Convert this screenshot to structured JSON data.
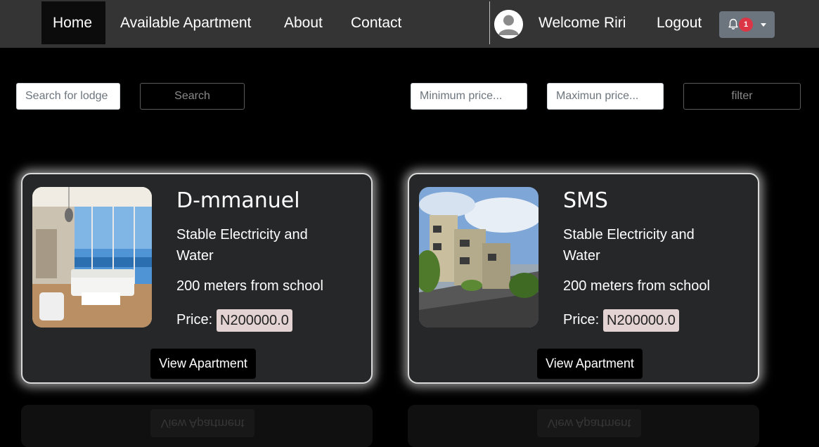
{
  "nav": {
    "items": [
      {
        "label": "Home",
        "active": true
      },
      {
        "label": "Available Apartment"
      },
      {
        "label": "About"
      },
      {
        "label": "Contact"
      }
    ],
    "welcome": "Welcome Riri",
    "logout": "Logout",
    "notifications": {
      "count": "1",
      "icon": "bell-icon"
    }
  },
  "search": {
    "placeholder": "Search for lodge",
    "button_label": "Search"
  },
  "filter": {
    "min_placeholder": "Minimum price...",
    "max_placeholder": "Maximun price...",
    "button_label": "filter"
  },
  "listings": [
    {
      "name": "D-mmanuel",
      "feature": "Stable Electricity and Water",
      "distance": "200 meters from school",
      "price_label": "Price:",
      "price": "N200000.0",
      "button": "View Apartment",
      "image": "apartment-interior-photo"
    },
    {
      "name": "SMS",
      "feature": "Stable Electricity and Water",
      "distance": "200 meters from school",
      "price_label": "Price:",
      "price": "N200000.0",
      "button": "View Apartment",
      "image": "apartment-building-photo"
    }
  ],
  "reflection": {
    "button": "View Apartment"
  },
  "colors": {
    "navbar": "#343434",
    "active_tab": "#0c0c0c",
    "card": "#262728",
    "price_tag": "#e3d3d3",
    "badge": "#dc3545",
    "notif_button": "#6c757d"
  }
}
